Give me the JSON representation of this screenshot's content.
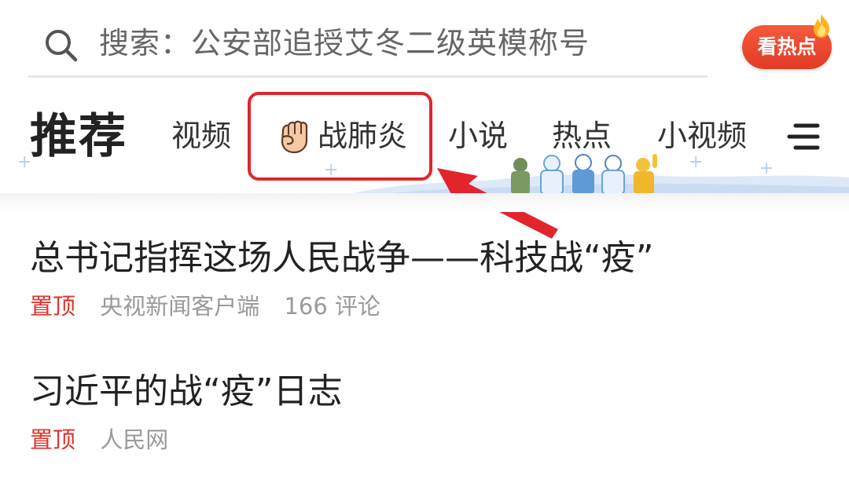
{
  "search": {
    "text": "搜索：公安部追授艾冬二级英模称号",
    "hot_button_label": "看热点",
    "search_icon": "search-icon",
    "hot_flame_icon": "flame-icon"
  },
  "tabs": {
    "title": "推荐",
    "items": [
      {
        "label": "视频"
      },
      {
        "label": "战肺炎",
        "icon": "fist-icon",
        "highlighted": true
      },
      {
        "label": "小说"
      },
      {
        "label": "热点"
      },
      {
        "label": "小视频"
      }
    ],
    "menu_icon": "menu-icon"
  },
  "news": [
    {
      "title": "总书记指挥这场人民战争——科技战“疫”",
      "badge": "置顶",
      "source": "央视新闻客户端",
      "comments": "166 评论"
    },
    {
      "title": "习近平的战“疫”日志",
      "badge": "置顶",
      "source": "人民网"
    }
  ],
  "colors": {
    "accent_red": "#e2242d",
    "badge_red": "#e0332e",
    "hot_button": "#ef4a2f",
    "meta_gray": "#9a9a9a",
    "text_dark": "#222222"
  }
}
